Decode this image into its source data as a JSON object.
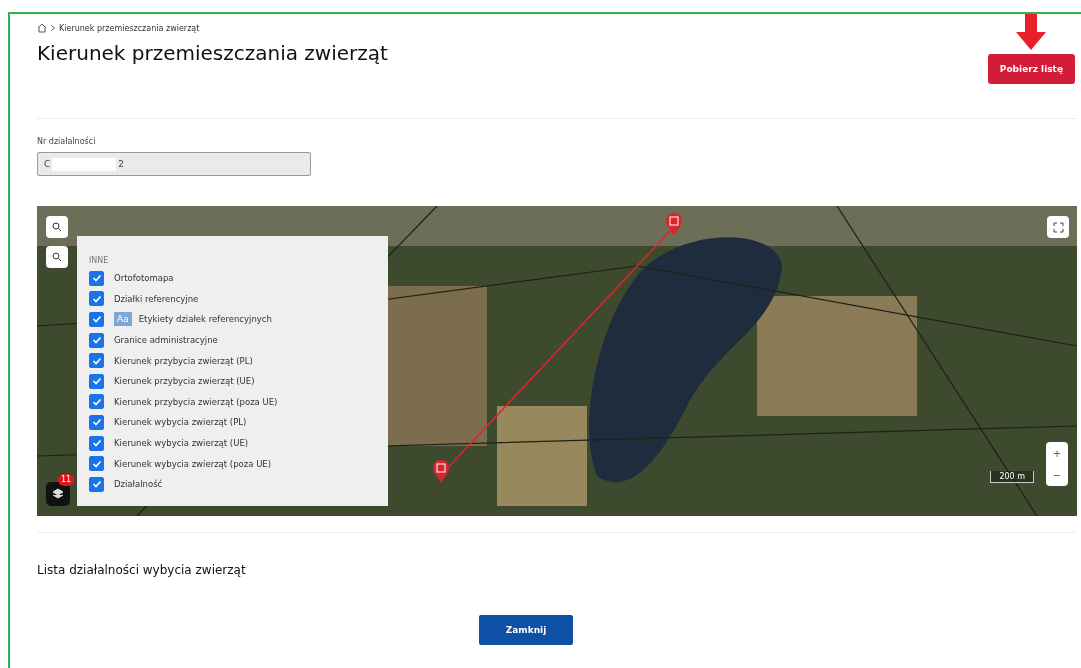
{
  "breadcrumb": {
    "current": "Kierunek przemieszczania zwierząt"
  },
  "title": "Kierunek przemieszczania zwierząt",
  "download_button": "Pobierz listę",
  "field": {
    "label": "Nr działalności",
    "value_start": "C",
    "value_end": "2"
  },
  "map": {
    "layers_group": "INNE",
    "layers": [
      {
        "label": "Ortofotomapa",
        "checked": true
      },
      {
        "label": "Działki referencyjne",
        "checked": true
      },
      {
        "label": "Etykiety działek referencyjnych",
        "checked": true,
        "badge": "Aa"
      },
      {
        "label": "Granice administracyjne",
        "checked": true
      },
      {
        "label": "Kierunek przybycia zwierząt (PL)",
        "checked": true
      },
      {
        "label": "Kierunek przybycia zwierząt (UE)",
        "checked": true
      },
      {
        "label": "Kierunek przybycia zwierząt (poza UE)",
        "checked": true
      },
      {
        "label": "Kierunek wybycia zwierząt (PL)",
        "checked": true
      },
      {
        "label": "Kierunek wybycia zwierząt (UE)",
        "checked": true
      },
      {
        "label": "Kierunek wybycia zwierząt (poza UE)",
        "checked": true
      },
      {
        "label": "Działalność",
        "checked": true
      }
    ],
    "layers_count": "11",
    "scale": "200 m",
    "zoom_in": "+",
    "zoom_out": "−"
  },
  "list_title": "Lista działalności wybycia zwierząt",
  "close_button": "Zamknij"
}
